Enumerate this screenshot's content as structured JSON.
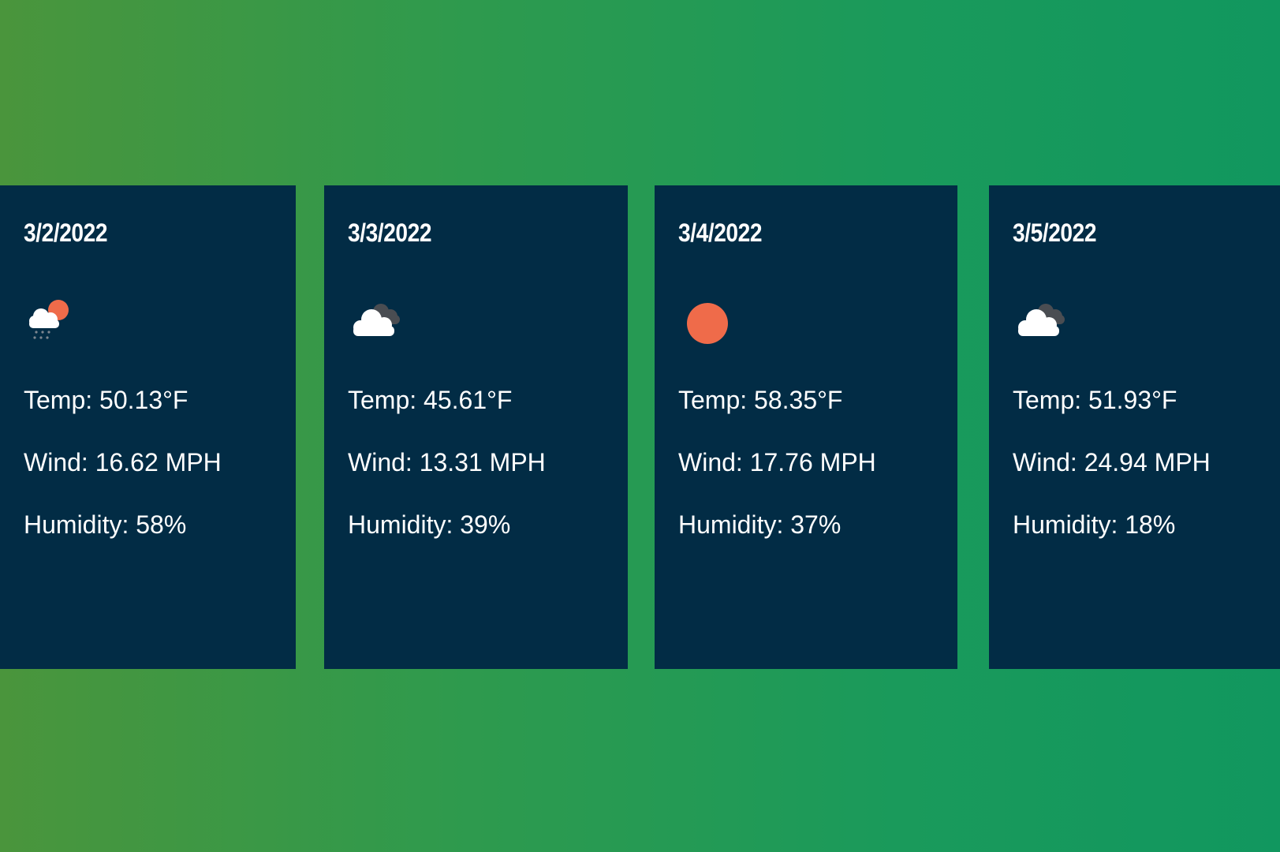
{
  "colors": {
    "card_background": "#022c45",
    "sun": "#ef6b4a",
    "cloud_front": "#ffffff",
    "cloud_back": "#4a4d52"
  },
  "forecast": [
    {
      "date": "3/2/2022",
      "icon": "rain-cloud-sun-icon",
      "temp": "Temp: 50.13°F",
      "wind": "Wind: 16.62 MPH",
      "humidity": "Humidity: 58%"
    },
    {
      "date": "3/3/2022",
      "icon": "broken-clouds-icon",
      "temp": "Temp: 45.61°F",
      "wind": "Wind: 13.31 MPH",
      "humidity": "Humidity: 39%"
    },
    {
      "date": "3/4/2022",
      "icon": "sun-icon",
      "temp": "Temp: 58.35°F",
      "wind": "Wind: 17.76 MPH",
      "humidity": "Humidity: 37%"
    },
    {
      "date": "3/5/2022",
      "icon": "broken-clouds-icon",
      "temp": "Temp: 51.93°F",
      "wind": "Wind: 24.94 MPH",
      "humidity": "Humidity: 18%"
    }
  ]
}
